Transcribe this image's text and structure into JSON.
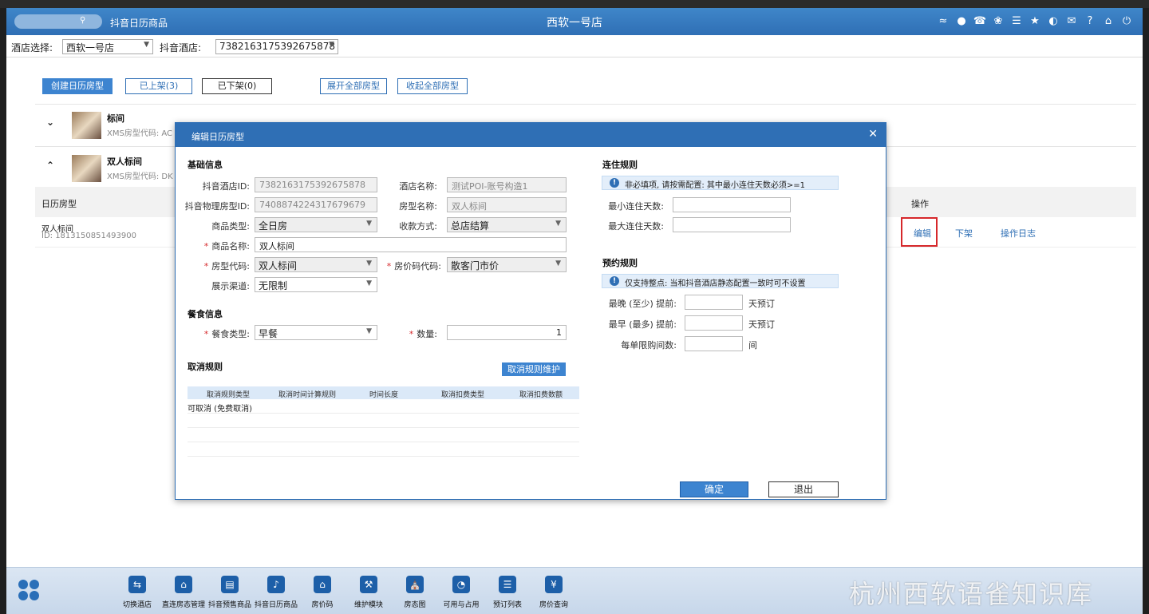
{
  "app": {
    "title": "抖音日历商品",
    "store_center": "西软一号店"
  },
  "filters": {
    "hotel_label": "酒店选择:",
    "hotel_value": "西软一号店",
    "douyin_label": "抖音酒店:",
    "douyin_value": "7382163175392675878"
  },
  "buttons": {
    "create": "创建日历房型",
    "listed": "已上架(3)",
    "unlisted": "已下架(0)",
    "expand_all": "展开全部房型",
    "collapse_all": "收起全部房型"
  },
  "rooms": [
    {
      "name": "标间",
      "code": "XMS房型代码: AC",
      "expanded": false
    },
    {
      "name": "双人标间",
      "code": "XMS房型代码: DK",
      "expanded": true
    }
  ],
  "table": {
    "col_room": "日历房型",
    "col_actions": "操作",
    "row": {
      "name": "双人标间",
      "id": "ID: 1813150851493900"
    },
    "actions": {
      "edit": "编辑",
      "delist": "下架",
      "log": "操作日志"
    }
  },
  "modal": {
    "title": "编辑日历房型",
    "basic": {
      "section": "基础信息",
      "douyin_hotel_id_label": "抖音酒店ID:",
      "douyin_hotel_id": "7382163175392675878",
      "hotel_name_label": "酒店名称:",
      "hotel_name": "测试POI-账号构造1",
      "douyin_room_id_label": "抖音物理房型ID:",
      "douyin_room_id": "7408874224317679679",
      "room_name_label": "房型名称:",
      "room_name": "双人标间",
      "product_type_label": "商品类型:",
      "product_type": "全日房",
      "payment_label": "收款方式:",
      "payment": "总店结算",
      "product_name_label": "商品名称:",
      "product_name": "双人标间",
      "room_code_label": "房型代码:",
      "room_code": "双人标间",
      "rate_code_label": "房价码代码:",
      "rate_code": "散客门市价",
      "channel_label": "展示渠道:",
      "channel": "无限制"
    },
    "meal": {
      "section": "餐食信息",
      "type_label": "餐食类型:",
      "type": "早餐",
      "qty_label": "数量:",
      "qty": "1"
    },
    "cancel": {
      "section": "取消规则",
      "maintain_btn": "取消规则维护",
      "headers": [
        "取消规则类型",
        "取消时间计算规则",
        "时间长度",
        "取消扣费类型",
        "取消扣费数额"
      ],
      "rows": [
        "可取消 (免费取消)",
        "",
        "",
        ""
      ]
    },
    "stay": {
      "section": "连住规则",
      "notice": "非必填项, 请按需配置: 其中最小连住天数必须>=1",
      "min_label": "最小连住天数:",
      "max_label": "最大连住天数:"
    },
    "booking": {
      "section": "预约规则",
      "notice": "仅支持整点: 当和抖音酒店静态配置一致时可不设置",
      "latest_label": "最晚 (至少) 提前:",
      "latest_unit": "天预订",
      "earliest_label": "最早 (最多) 提前:",
      "earliest_unit": "天预订",
      "limit_label": "每单限购间数:",
      "limit_unit": "间"
    },
    "ok": "确定",
    "exit": "退出"
  },
  "taskbar": {
    "items": [
      {
        "label": "切换酒店",
        "icon": "switch-icon"
      },
      {
        "label": "直连房态管理",
        "icon": "house-icon"
      },
      {
        "label": "抖音预售商品",
        "icon": "ticket-icon"
      },
      {
        "label": "抖音日历商品",
        "icon": "tiktok-icon"
      },
      {
        "label": "房价码",
        "icon": "home-icon"
      },
      {
        "label": "维护模块",
        "icon": "wrench-icon"
      },
      {
        "label": "房态图",
        "icon": "bank-icon"
      },
      {
        "label": "可用与占用",
        "icon": "pie-icon"
      },
      {
        "label": "预订列表",
        "icon": "list-icon"
      },
      {
        "label": "房价查询",
        "icon": "price-search-icon"
      }
    ],
    "watermark": "杭州西软语雀知识库"
  },
  "colors": {
    "accent": "#2f6fb5",
    "highlight": "#d6282b"
  }
}
